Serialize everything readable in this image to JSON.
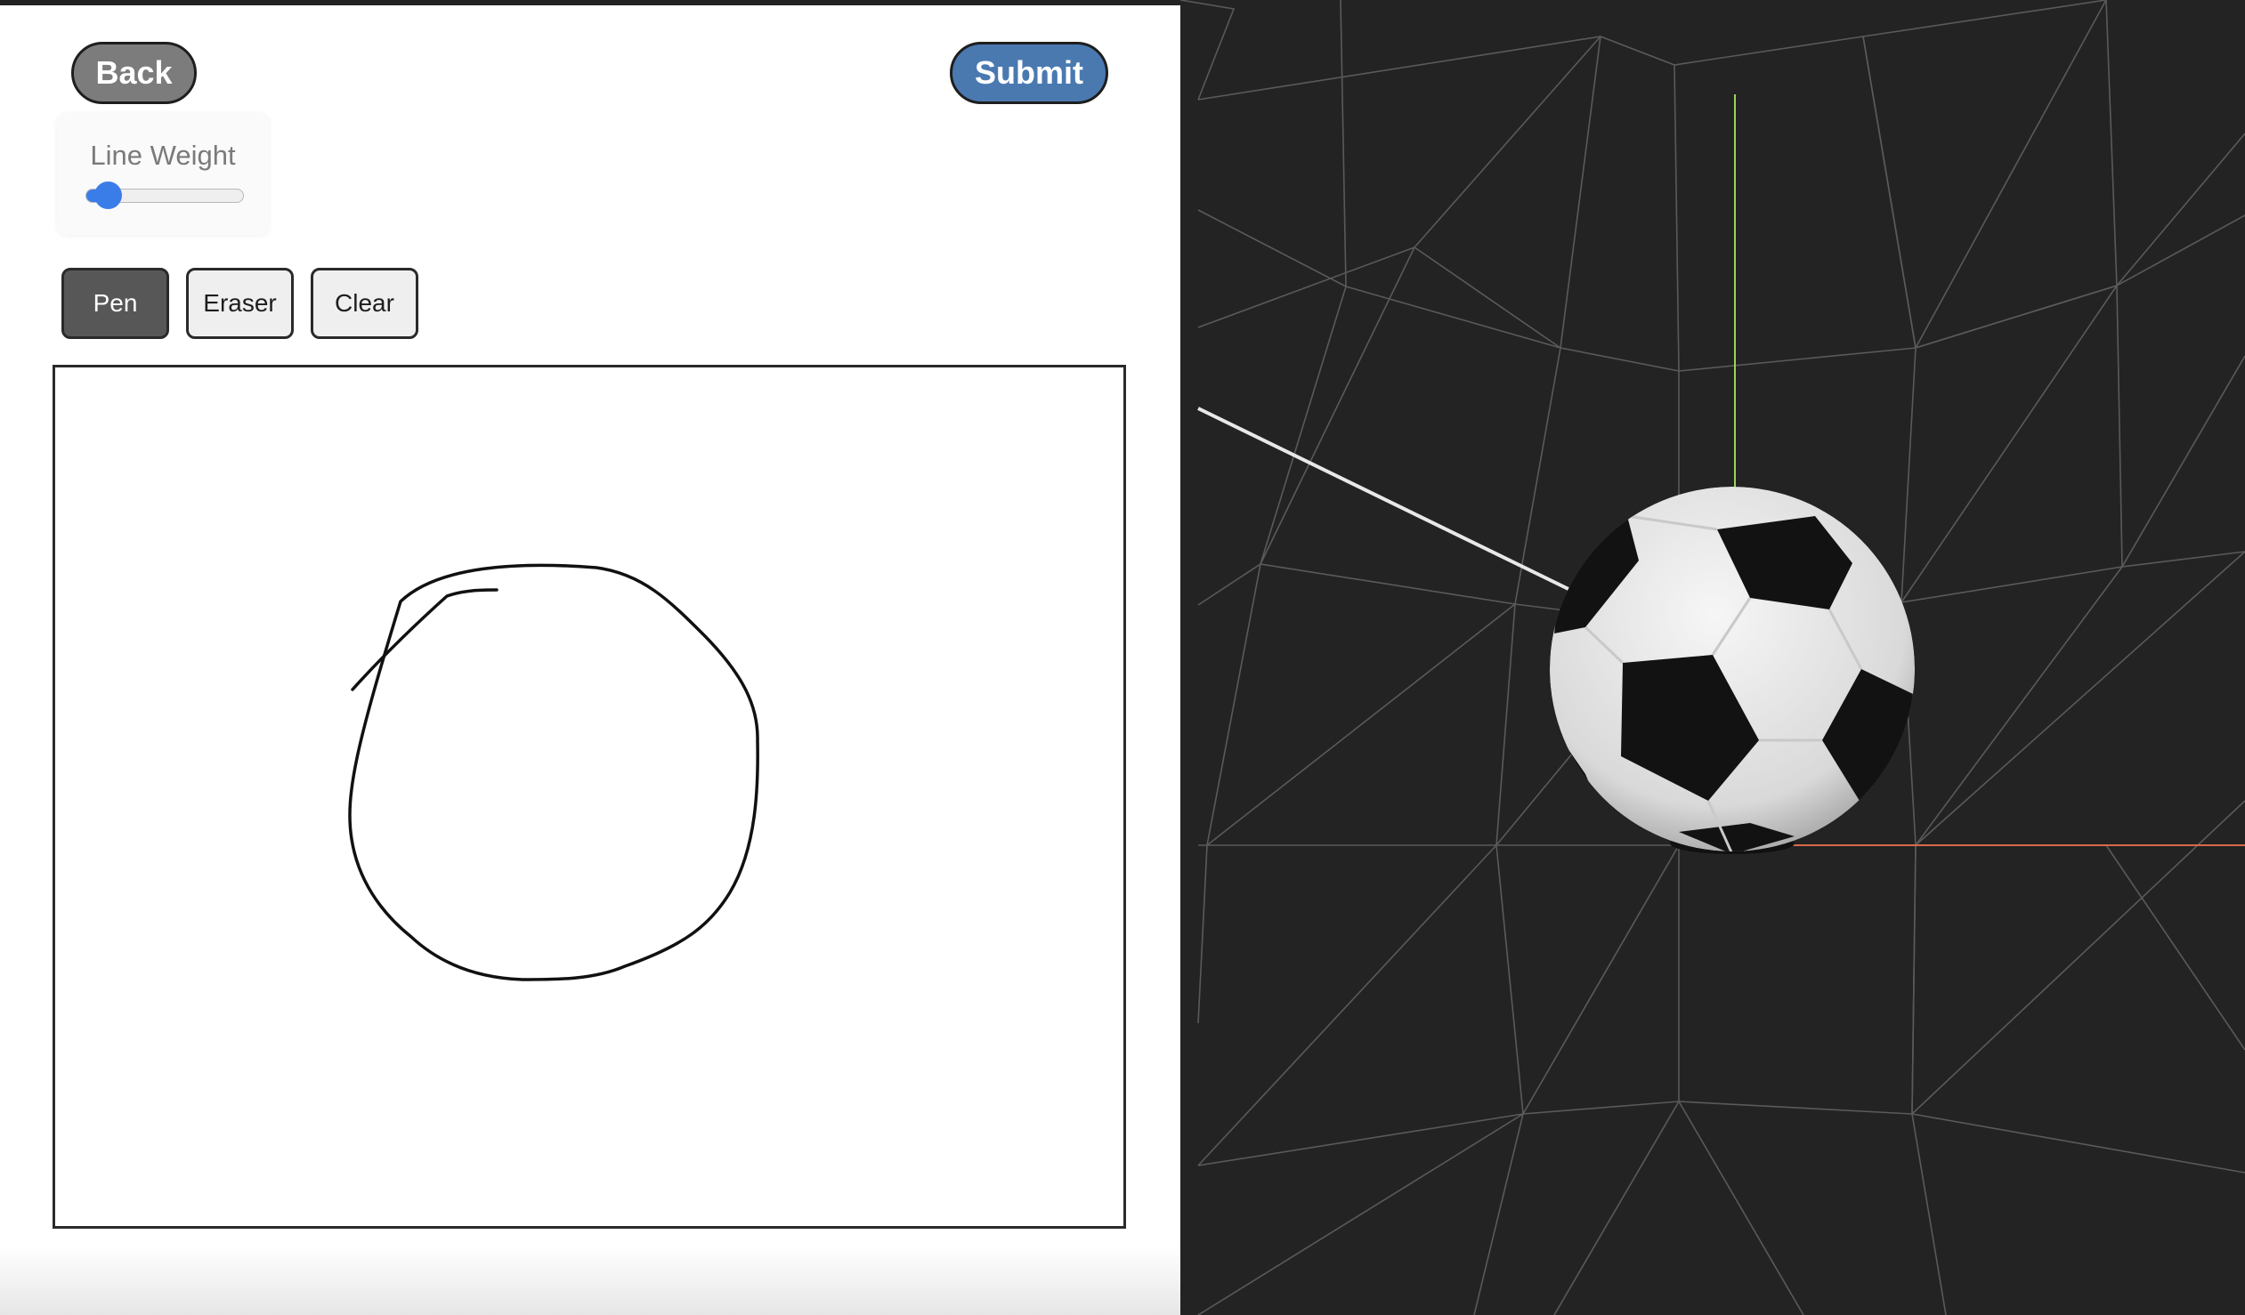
{
  "toolbar": {
    "back_label": "Back",
    "submit_label": "Submit"
  },
  "line_weight": {
    "label": "Line Weight",
    "value_fraction": 0.1
  },
  "tools": {
    "pen_label": "Pen",
    "eraser_label": "Eraser",
    "clear_label": "Clear",
    "active": "pen"
  },
  "colors": {
    "back_button": "#7c7c7c",
    "submit_button": "#4a79b0",
    "slider_accent": "#3b7de8",
    "active_tool": "#575757",
    "viewport_background": "#232323",
    "y_axis": "#9bd35a",
    "x_axis": "#d9694a"
  },
  "viewport": {
    "object": "soccer-ball"
  }
}
